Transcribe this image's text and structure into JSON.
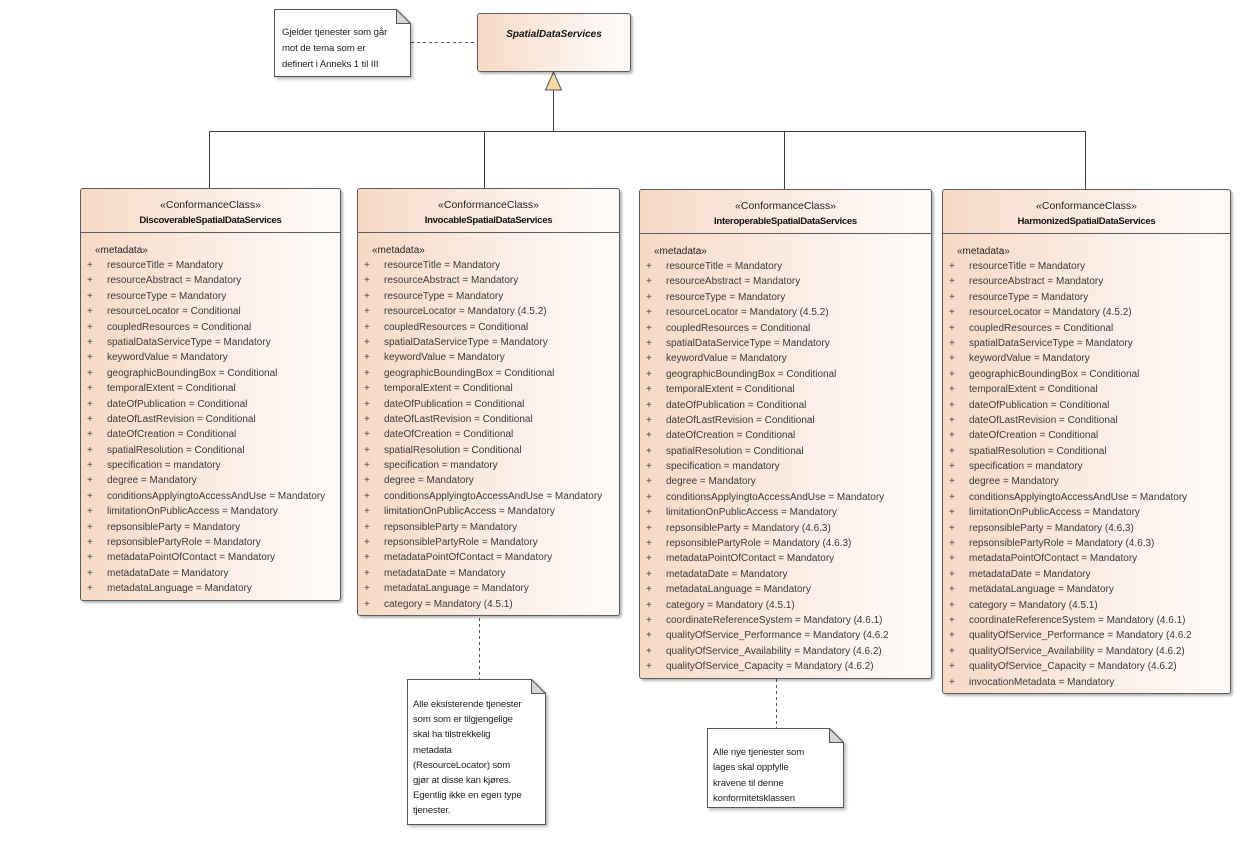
{
  "superclass": {
    "name": "SpatialDataServices"
  },
  "notes": [
    {
      "lines": [
        "Gjelder tjenester som går",
        "mot de tema som er",
        "definert i Anneks 1 til III"
      ]
    },
    {
      "lines": [
        "Alle eksisterende tjenester",
        "som som er tilgjengelige",
        "skal ha tilstrekkelig",
        "metadata",
        "(ResourceLocator) som",
        "gjør at disse kan kjøres.",
        "Egentlig ikke en egen type",
        "tjenester."
      ]
    },
    {
      "lines": [
        "Alle nye tjenester som",
        "lages skal oppfylle",
        "kravene til denne",
        "konformitetsklassen"
      ]
    }
  ],
  "classes": [
    {
      "stereotype": "«ConformanceClass»",
      "name": "DiscoverableSpatialDataServices",
      "compartment_stereotype": "«metadata»",
      "visibility_symbol": "+",
      "attributes": [
        "resourceTitle = Mandatory",
        "resourceAbstract = Mandatory",
        "resourceType = Mandatory",
        "resourceLocator = Conditional",
        "coupledResources = Conditional",
        "spatialDataServiceType = Mandatory",
        "keywordValue = Mandatory",
        "geographicBoundingBox = Conditional",
        "temporalExtent = Conditional",
        "dateOfPublication = Conditional",
        "dateOfLastRevision = Conditional",
        "dateOfCreation = Conditional",
        "spatialResolution = Conditional",
        "specification = mandatory",
        "degree = Mandatory",
        "conditionsApplyingtoAccessAndUse = Mandatory",
        "limitationOnPublicAccess = Mandatory",
        "repsonsibleParty = Mandatory",
        "repsonsiblePartyRole = Mandatory",
        "metadataPointOfContact = Mandatory",
        "metadataDate = Mandatory",
        "metadataLanguage = Mandatory"
      ]
    },
    {
      "stereotype": "«ConformanceClass»",
      "name": "InvocableSpatialDataServices",
      "compartment_stereotype": "«metadata»",
      "visibility_symbol": "+",
      "attributes": [
        "resourceTitle = Mandatory",
        "resourceAbstract = Mandatory",
        "resourceType = Mandatory",
        "resourceLocator = Mandatory (4.5.2)",
        "coupledResources = Conditional",
        "spatialDataServiceType = Mandatory",
        "keywordValue = Mandatory",
        "geographicBoundingBox = Conditional",
        "temporalExtent = Conditional",
        "dateOfPublication = Conditional",
        "dateOfLastRevision = Conditional",
        "dateOfCreation = Conditional",
        "spatialResolution = Conditional",
        "specification = mandatory",
        "degree = Mandatory",
        "conditionsApplyingtoAccessAndUse = Mandatory",
        "limitationOnPublicAccess = Mandatory",
        "repsonsibleParty = Mandatory",
        "repsonsiblePartyRole = Mandatory",
        "metadataPointOfContact = Mandatory",
        "metadataDate = Mandatory",
        "metadataLanguage = Mandatory",
        "category = Mandatory (4.5.1)"
      ]
    },
    {
      "stereotype": "«ConformanceClass»",
      "name": "InteroperableSpatialDataServices",
      "compartment_stereotype": "«metadata»",
      "visibility_symbol": "+",
      "attributes": [
        "resourceTitle = Mandatory",
        "resourceAbstract = Mandatory",
        "resourceType = Mandatory",
        "resourceLocator = Mandatory (4.5.2)",
        "coupledResources = Conditional",
        "spatialDataServiceType = Mandatory",
        "keywordValue = Mandatory",
        "geographicBoundingBox = Conditional",
        "temporalExtent = Conditional",
        "dateOfPublication = Conditional",
        "dateOfLastRevision = Conditional",
        "dateOfCreation = Conditional",
        "spatialResolution = Conditional",
        "specification = mandatory",
        "degree = Mandatory",
        "conditionsApplyingtoAccessAndUse = Mandatory",
        "limitationOnPublicAccess = Mandatory",
        "repsonsibleParty = Mandatory (4.6.3)",
        "repsonsiblePartyRole = Mandatory (4.6.3)",
        "metadataPointOfContact = Mandatory",
        "metadataDate = Mandatory",
        "metadataLanguage = Mandatory",
        "category = Mandatory (4.5.1)",
        "coordinateReferenceSystem = Mandatory (4.6.1)",
        "qualityOfService_Performance = Mandatory (4.6.2",
        "qualityOfService_Availability = Mandatory (4.6.2)",
        "qualityOfService_Capacity = Mandatory (4.6.2)"
      ]
    },
    {
      "stereotype": "«ConformanceClass»",
      "name": "HarmonizedSpatialDataServices",
      "compartment_stereotype": "«metadata»",
      "visibility_symbol": "+",
      "attributes": [
        "resourceTitle = Mandatory",
        "resourceAbstract = Mandatory",
        "resourceType = Mandatory",
        "resourceLocator = Mandatory (4.5.2)",
        "coupledResources = Conditional",
        "spatialDataServiceType = Mandatory",
        "keywordValue = Mandatory",
        "geographicBoundingBox = Conditional",
        "temporalExtent = Conditional",
        "dateOfPublication = Conditional",
        "dateOfLastRevision = Conditional",
        "dateOfCreation = Conditional",
        "spatialResolution = Conditional",
        "specification = mandatory",
        "degree = Mandatory",
        "conditionsApplyingtoAccessAndUse = Mandatory",
        "limitationOnPublicAccess = Mandatory",
        "repsonsibleParty = Mandatory (4.6.3)",
        "repsonsiblePartyRole = Mandatory (4.6.3)",
        "metadataPointOfContact = Mandatory",
        "metadataDate = Mandatory",
        "metadataLanguage = Mandatory",
        "category = Mandatory (4.5.1)",
        "coordinateReferenceSystem = Mandatory (4.6.1)",
        "qualityOfService_Performance = Mandatory (4.6.2",
        "qualityOfService_Availability = Mandatory (4.6.2)",
        "qualityOfService_Capacity = Mandatory (4.6.2)",
        "invocationMetadata = Mandatory"
      ]
    }
  ],
  "colors": {
    "class_fill_start": "#f6d9c5",
    "class_fill_end": "#fffbf8",
    "generalization_arrowhead": "#fad9a6",
    "line": "#3c3c3c"
  }
}
